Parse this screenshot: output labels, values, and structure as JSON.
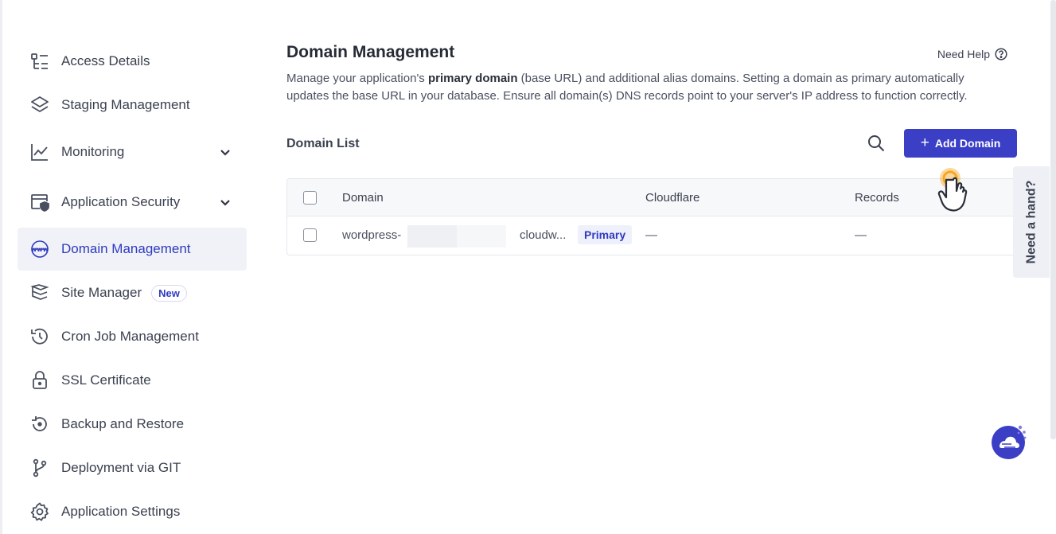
{
  "sidebar": {
    "items": [
      {
        "label": "Access Details",
        "icon": "access-details-icon"
      },
      {
        "label": "Staging Management",
        "icon": "layers-icon"
      },
      {
        "label": "Monitoring",
        "icon": "chart-line-icon",
        "expandable": true
      },
      {
        "label": "Application Security",
        "icon": "shield-window-icon",
        "expandable": true
      },
      {
        "label": "Domain Management",
        "icon": "www-globe-icon",
        "active": true
      },
      {
        "label": "Site Manager",
        "icon": "site-manager-icon",
        "badge": "New"
      },
      {
        "label": "Cron Job Management",
        "icon": "history-clock-icon"
      },
      {
        "label": "SSL Certificate",
        "icon": "lock-icon"
      },
      {
        "label": "Backup and Restore",
        "icon": "backup-restore-icon"
      },
      {
        "label": "Deployment via GIT",
        "icon": "git-branch-icon"
      },
      {
        "label": "Application Settings",
        "icon": "gear-icon"
      }
    ]
  },
  "main": {
    "title": "Domain Management",
    "need_help": "Need Help",
    "description": {
      "before": "Manage your application's ",
      "bold": "primary domain",
      "after": " (base URL) and additional alias domains. Setting a domain as primary automatically updates the base URL in your database. Ensure all domain(s) DNS records point to your server's IP address to function correctly."
    },
    "list_title": "Domain List",
    "add_button": "Add Domain",
    "table": {
      "headers": {
        "domain": "Domain",
        "cloudflare": "Cloudflare",
        "records": "Records"
      },
      "rows": [
        {
          "domain_prefix": "wordpress-",
          "domain_suffix": "cloudw...",
          "badge": "Primary",
          "cloudflare": "—",
          "records": "—"
        }
      ]
    }
  },
  "help_tab": "Need a hand?",
  "colors": {
    "accent": "#3a3fc6",
    "active_bg": "#f1f2f8",
    "pointer_highlight": "#f5a623"
  }
}
